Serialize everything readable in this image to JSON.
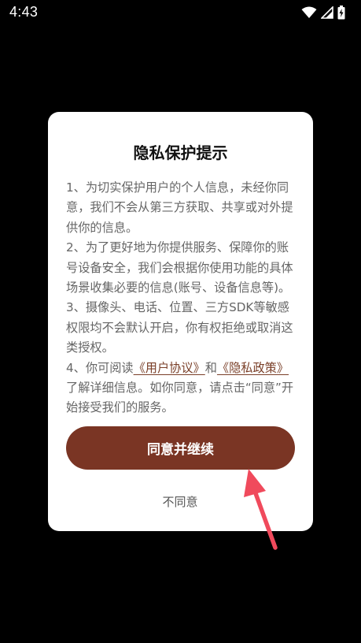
{
  "status_bar": {
    "time": "4:43",
    "icons": [
      "wifi-icon",
      "signal-icon",
      "battery-charging-icon"
    ]
  },
  "dialog": {
    "title": "隐私保护提示",
    "paragraph1": "1、为切实保护用户的个人信息，未经你同意，我们不会从第三方获取、共享或对外提供你的信息。",
    "paragraph2": "2、为了更好地为你提供服务、保障你的账号设备安全，我们会根据你使用功能的具体场景收集必要的信息(账号、设备信息等)。",
    "paragraph3": "3、摄像头、电话、位置、三方SDK等敏感权限均不会默认开启，你有权拒绝或取消这类授权。",
    "paragraph4_prefix": "4、你可阅读",
    "user_agreement_link": "《用户协议》",
    "paragraph4_and": "和",
    "privacy_policy_link": "《隐私政策》",
    "paragraph4_suffix": "了解详细信息。如你同意，请点击“同意”开始接受我们的服务。",
    "agree_label": "同意并继续",
    "disagree_label": "不同意"
  },
  "colors": {
    "background": "#000000",
    "dialog_background": "#ffffff",
    "accent": "#7a3524",
    "link": "#7a3f28",
    "annotation_arrow": "#f04a5c"
  }
}
